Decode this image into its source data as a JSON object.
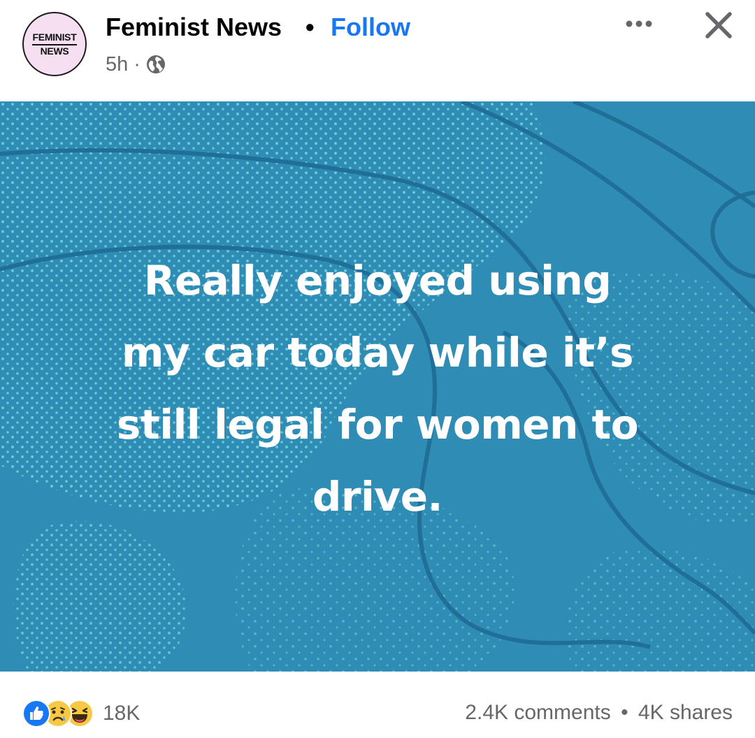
{
  "header": {
    "avatar_line1": "FEMINIST",
    "avatar_line2": "NEWS",
    "page_name": "Feminist News",
    "separator": "•",
    "follow_label": "Follow",
    "time": "5h",
    "meta_separator": "·",
    "privacy_icon": "globe-icon",
    "more_icon": "more-options-icon",
    "close_icon": "close-icon"
  },
  "post": {
    "image_text_lines": [
      "Really enjoyed using",
      "my car today while it’s",
      "still legal for women to",
      "drive."
    ],
    "background_color": "#2f8db5"
  },
  "footer": {
    "reaction_icons": [
      "like-icon",
      "sad-icon",
      "haha-icon"
    ],
    "reaction_count": "18K",
    "comments": "2.4K comments",
    "stats_separator": "•",
    "shares": "4K shares"
  },
  "colors": {
    "accent": "#1877f2",
    "secondary_text": "#65676b",
    "avatar_bg": "#f6dff0"
  }
}
